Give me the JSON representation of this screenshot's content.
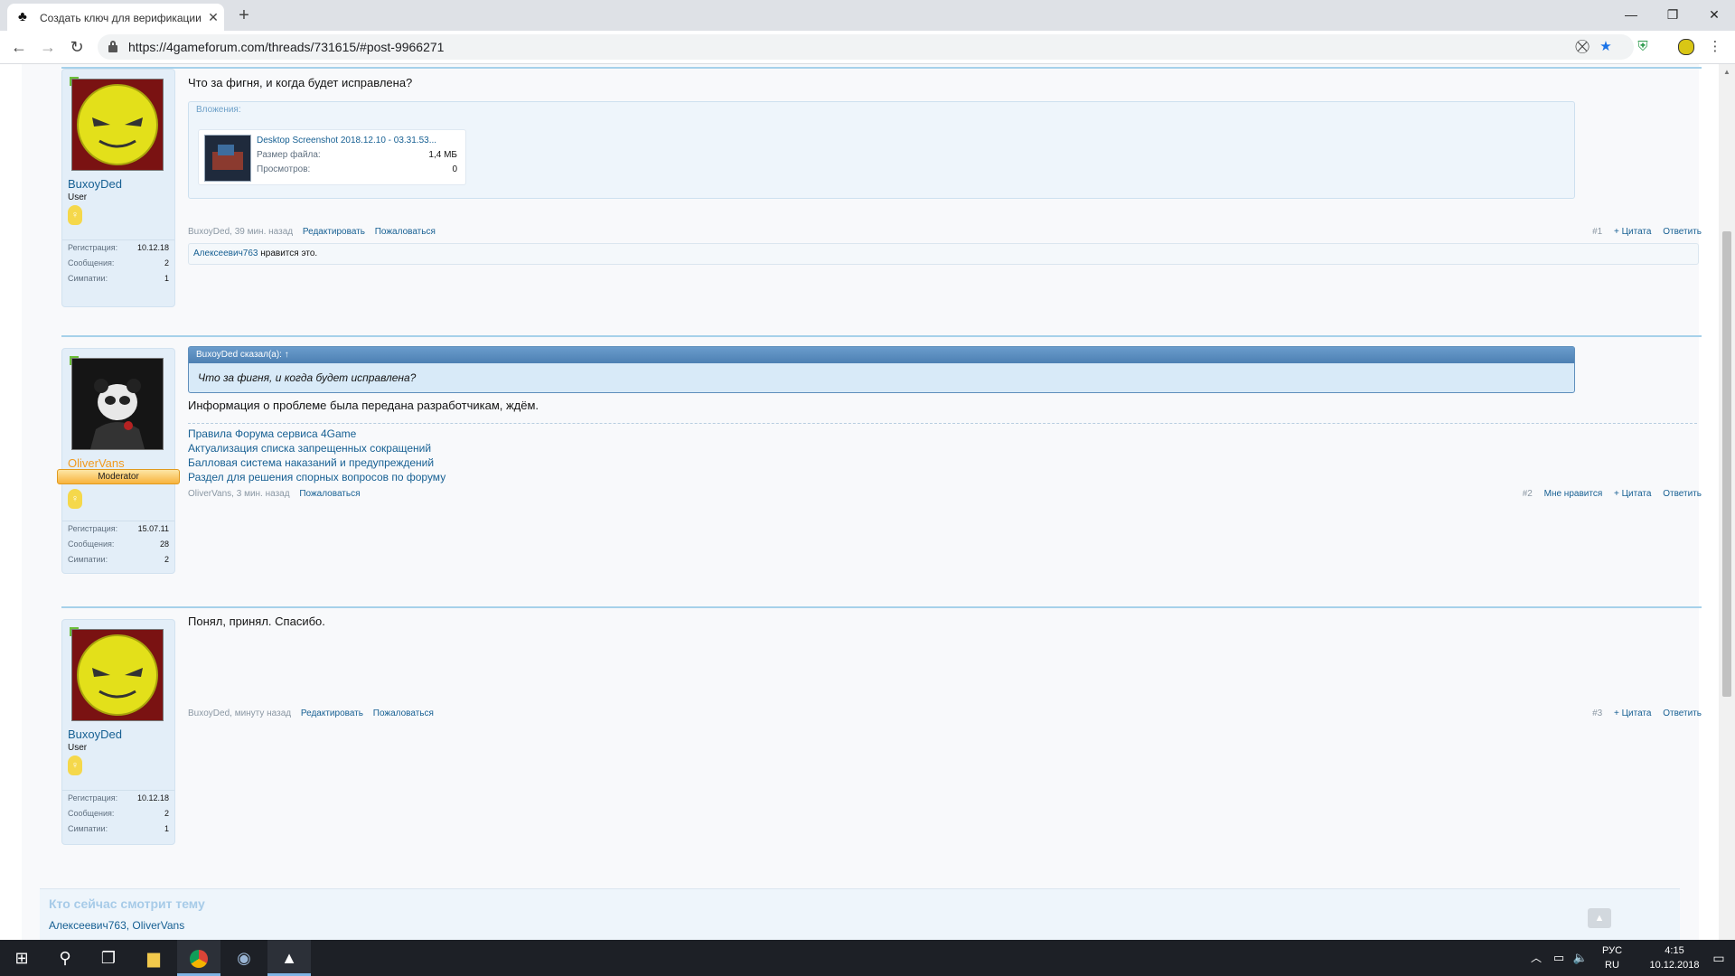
{
  "browser": {
    "tab_title": "Создать ключ для верификации",
    "tab_icon": "clover-icon",
    "url": "https://4gameforum.com/threads/731615/#post-9966271",
    "controls": {
      "minimize": "—",
      "maximize": "❐",
      "close": "✕",
      "new_tab": "+",
      "back": "←",
      "forward": "→",
      "reload": "↻"
    }
  },
  "posts": [
    {
      "author": "BuxoyDed",
      "user_title": "User",
      "avatar": "angry-smiley-avatar",
      "stats": [
        {
          "label": "Регистрация:",
          "value": "10.12.18"
        },
        {
          "label": "Сообщения:",
          "value": "2"
        },
        {
          "label": "Симпатии:",
          "value": "1"
        }
      ],
      "message": "Что за фигня, и когда будет исправлена?",
      "attachments_label": "Вложения:",
      "attachment": {
        "name": "Desktop Screenshot 2018.12.10 - 03.31.53...",
        "size_label": "Размер файла:",
        "size": "1,4 МБ",
        "views_label": "Просмотров:",
        "views": "0"
      },
      "meta_author": "BuxoyDed",
      "meta_time": ", 39 мин. назад",
      "actions": [
        "Редактировать",
        "Пожаловаться"
      ],
      "post_number": "#1",
      "controls": [
        "+ Цитата",
        "Ответить"
      ],
      "liked_by": "Алексеевич763",
      "liked_suffix": "нравится это."
    },
    {
      "author": "OliverVans",
      "user_title": "Moderator",
      "avatar": "panda-avatar",
      "stats": [
        {
          "label": "Регистрация:",
          "value": "15.07.11"
        },
        {
          "label": "Сообщения:",
          "value": "28"
        },
        {
          "label": "Симпатии:",
          "value": "2"
        }
      ],
      "quote_header": "BuxoyDed сказал(а): ↑",
      "quote_text": "Что за фигня, и когда будет исправлена?",
      "message": "Информация о проблеме была передана разработчикам, ждём.",
      "signature": [
        "Правила Форума сервиса 4Game",
        "Актуализация списка запрещенных сокращений",
        "Балловая система наказаний и предупреждений",
        "Раздел для решения спорных вопросов по форуму"
      ],
      "meta_author": "OliverVans",
      "meta_time": ", 3 мин. назад",
      "actions": [
        "Пожаловаться"
      ],
      "post_number": "#2",
      "controls": [
        "Мне нравится",
        "+ Цитата",
        "Ответить"
      ]
    },
    {
      "author": "BuxoyDed",
      "user_title": "User",
      "avatar": "angry-smiley-avatar",
      "stats": [
        {
          "label": "Регистрация:",
          "value": "10.12.18"
        },
        {
          "label": "Сообщения:",
          "value": "2"
        },
        {
          "label": "Симпатии:",
          "value": "1"
        }
      ],
      "message": "Понял, принял. Спасибо.",
      "meta_author": "BuxoyDed",
      "meta_time": ", минуту назад",
      "actions": [
        "Редактировать",
        "Пожаловаться"
      ],
      "post_number": "#3",
      "controls": [
        "+ Цитата",
        "Ответить"
      ]
    }
  ],
  "viewers": {
    "title": "Кто сейчас смотрит тему",
    "users": "Алексеевич763, OliverVans"
  },
  "taskbar": {
    "language": "РУС",
    "layout": "RU",
    "time": "4:15",
    "date": "10.12.2018"
  },
  "colors": {
    "link": "#176093",
    "accent_line": "#a6d1ea",
    "moderator_banner": "#f8b33d",
    "username_moderator": "#f19a1e"
  }
}
